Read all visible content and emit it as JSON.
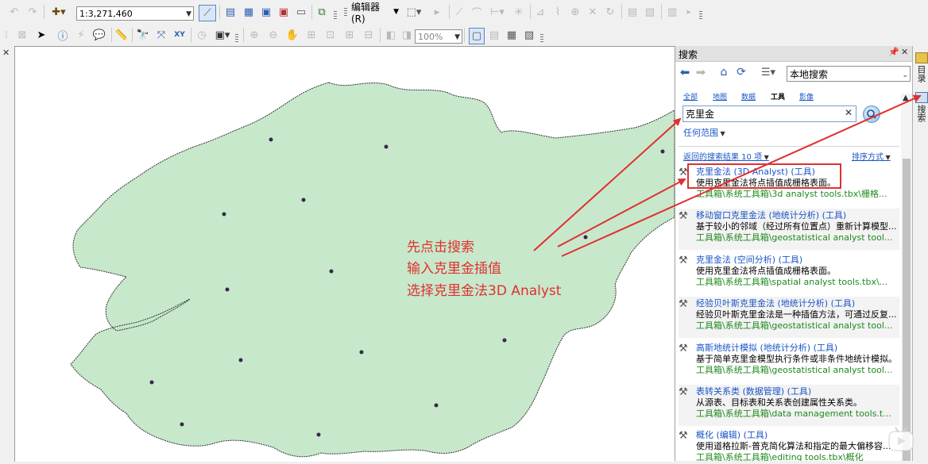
{
  "toolbar": {
    "scale_value": "1:3,271,460",
    "editor_menu_label": "编辑器(R)",
    "zoom_value": "100%"
  },
  "search_panel": {
    "title": "搜索",
    "pin_icon": "pin-icon",
    "close_icon": "close-icon",
    "scope_dropdown": "本地搜索",
    "category_tabs": [
      {
        "label": "全部"
      },
      {
        "label": "地图"
      },
      {
        "label": "数据"
      },
      {
        "label": "工具"
      },
      {
        "label": "影像"
      }
    ],
    "search_value": "克里金",
    "any_extent_label": "任何范围",
    "results_count_label": "返回的搜索结果 10 项",
    "sort_label": "排序方式",
    "results": [
      {
        "title": "克里金法 (3D Analyst) (工具)",
        "desc": "使用克里金法将点插值成栅格表面。",
        "path": "工具箱\\系统工具箱\\3d analyst tools.tbx\\栅格..."
      },
      {
        "title": "移动窗口克里金法 (地统计分析) (工具)",
        "desc": "基于较小的邻域（经过所有位置点）重新计算模型...",
        "path": "工具箱\\系统工具箱\\geostatistical analyst tool..."
      },
      {
        "title": "克里金法 (空间分析) (工具)",
        "desc": "使用克里金法将点插值成栅格表面。",
        "path": "工具箱\\系统工具箱\\spatial analyst tools.tbx\\..."
      },
      {
        "title": "经验贝叶斯克里金法 (地统计分析) (工具)",
        "desc": "经验贝叶斯克里金法是一种插值方法，可通过反复...",
        "path": "工具箱\\系统工具箱\\geostatistical analyst tool..."
      },
      {
        "title": "高斯地统计模拟 (地统计分析) (工具)",
        "desc": "基于简单克里金模型执行条件或非条件地统计模拟。",
        "path": "工具箱\\系统工具箱\\geostatistical analyst tool..."
      },
      {
        "title": "表转关系类 (数据管理) (工具)",
        "desc": "从源表、目标表和关系表创建属性关系类。",
        "path": "工具箱\\系统工具箱\\data management tools.t..."
      },
      {
        "title": "概化 (编辑) (工具)",
        "desc": "使用道格拉斯-普克简化算法和指定的最大偏移容...",
        "path": "工具箱\\系统工具箱\\editing tools.tbx\\概化"
      }
    ]
  },
  "right_strip": {
    "tab1": "目录",
    "tab2": "搜索"
  },
  "annotation": {
    "line1": "先点击搜索",
    "line2": "输入克里金插值",
    "line3": "选择克里金法3D Analyst"
  },
  "colors": {
    "map_fill": "#c7e8cb",
    "annotation_red": "#e03030",
    "link_blue": "#1a55c6",
    "path_green": "#1e8a1e"
  }
}
